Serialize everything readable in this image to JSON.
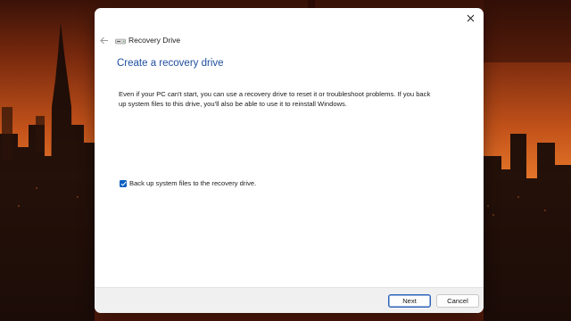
{
  "window": {
    "title": "Recovery Drive"
  },
  "page": {
    "heading": "Create a recovery drive",
    "description": "Even if your PC can't start, you can use a recovery drive to reset it or troubleshoot problems. If you back up system files to this drive, you'll also be able to use it to reinstall Windows."
  },
  "options": {
    "backup_label": "Back up system files to the recovery drive.",
    "backup_checked": true
  },
  "footer": {
    "next_label": "Next",
    "cancel_label": "Cancel"
  },
  "icons": {
    "close": "close-icon",
    "back": "back-arrow-icon",
    "app": "drive-icon",
    "check": "check-icon"
  },
  "colors": {
    "heading": "#1f4fa0",
    "accent": "#0a5fc2",
    "footer_bg": "#f0f0f0"
  }
}
